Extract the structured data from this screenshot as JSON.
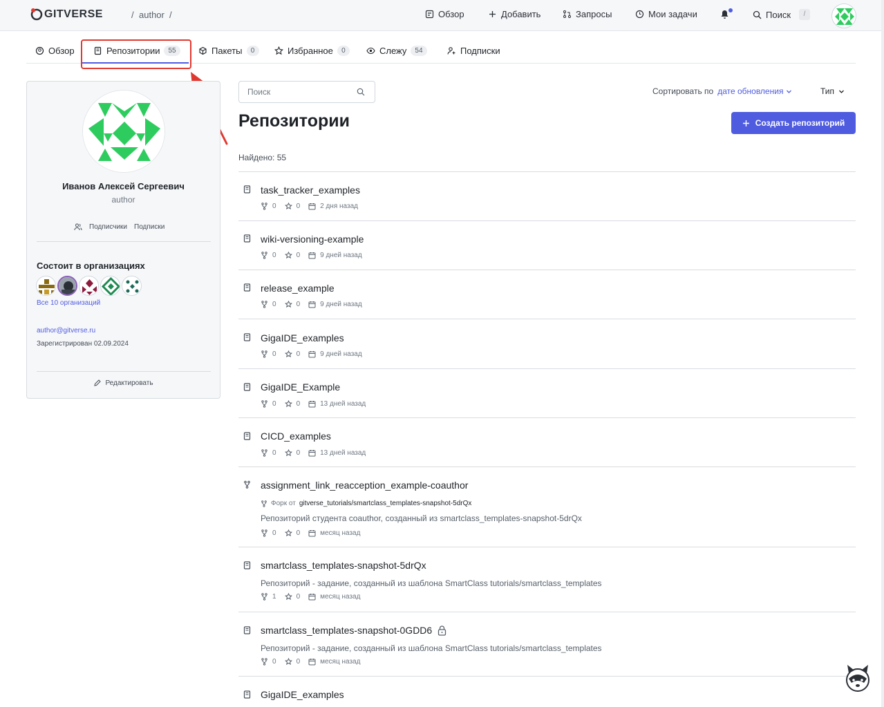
{
  "header": {
    "logo_text": "GITVERSE",
    "breadcrumb_user": "author",
    "breadcrumb_sep1": "/",
    "breadcrumb_sep2": "/",
    "nav": {
      "overview": "Обзор",
      "add": "Добавить",
      "requests": "Запросы",
      "tasks": "Мои задачи",
      "search": "Поиск",
      "search_shortcut": "/"
    },
    "icons": [
      "logo-icon",
      "overview-icon",
      "plus-icon",
      "pull-request-icon",
      "tasks-icon",
      "bell-icon",
      "search-icon",
      "avatar"
    ]
  },
  "tabs": [
    {
      "label": "Обзор",
      "icon": "user-circle-icon"
    },
    {
      "label": "Репозитории",
      "icon": "repo-icon",
      "count": "55",
      "active": true
    },
    {
      "label": "Пакеты",
      "icon": "package-icon",
      "count": "0"
    },
    {
      "label": "Избранное",
      "icon": "star-icon",
      "count": "0"
    },
    {
      "label": "Слежу",
      "icon": "eye-icon",
      "count": "54"
    },
    {
      "label": "Подписки",
      "icon": "user-plus-icon"
    }
  ],
  "profile": {
    "full_name": "Иванов Алексей Сергеевич",
    "login": "author",
    "followers_label": "Подписчики",
    "following_label": "Подписки",
    "orgs_title": "Состоит в организациях",
    "all_orgs_link": "Все 10 организаций",
    "email": "author@gitverse.ru",
    "registered": "Зарегистрирован 02.09.2024",
    "edit_label": "Редактировать"
  },
  "main": {
    "search_placeholder": "Поиск",
    "sort_label": "Сортировать по",
    "sort_value": "дате обновления",
    "type_label": "Тип",
    "title": "Репозитории",
    "create_button": "Создать репозиторий",
    "found": "Найдено: 55"
  },
  "repos": [
    {
      "name": "task_tracker_examples",
      "forks": "0",
      "stars": "0",
      "updated": "2 дня назад"
    },
    {
      "name": "wiki-versioning-example",
      "forks": "0",
      "stars": "0",
      "updated": "9 дней назад"
    },
    {
      "name": "release_example",
      "forks": "0",
      "stars": "0",
      "updated": "9 дней назад"
    },
    {
      "name": "GigaIDE_examples",
      "forks": "0",
      "stars": "0",
      "updated": "9 дней назад"
    },
    {
      "name": "GigaIDE_Example",
      "forks": "0",
      "stars": "0",
      "updated": "13 дней назад"
    },
    {
      "name": "CICD_examples",
      "forks": "0",
      "stars": "0",
      "updated": "13 дней назад"
    },
    {
      "name": "assignment_link_reacception_example-coauthor",
      "fork_prefix": "Форк от",
      "fork_source": "gitverse_tutorials/smartclass_templates-snapshot-5drQx",
      "description": "Репозиторий студента coauthor, созданный из smartclass_templates-snapshot-5drQx",
      "forks": "0",
      "stars": "0",
      "updated": "месяц назад"
    },
    {
      "name": "smartclass_templates-snapshot-5drQx",
      "description": "Репозиторий - задание, созданный из шаблона SmartClass tutorials/smartclass_templates",
      "forks": "1",
      "stars": "0",
      "updated": "месяц назад"
    },
    {
      "name": "smartclass_templates-snapshot-0GDD6",
      "private": true,
      "description": "Репозиторий - задание, созданный из шаблона SmartClass tutorials/smartclass_templates",
      "forks": "0",
      "stars": "0",
      "updated": "месяц назад"
    },
    {
      "name": "GigaIDE_examples"
    }
  ],
  "colors": {
    "accent": "#4f5ce0",
    "highlight": "#e0382f",
    "avatar_green": "#2ecc5e"
  }
}
